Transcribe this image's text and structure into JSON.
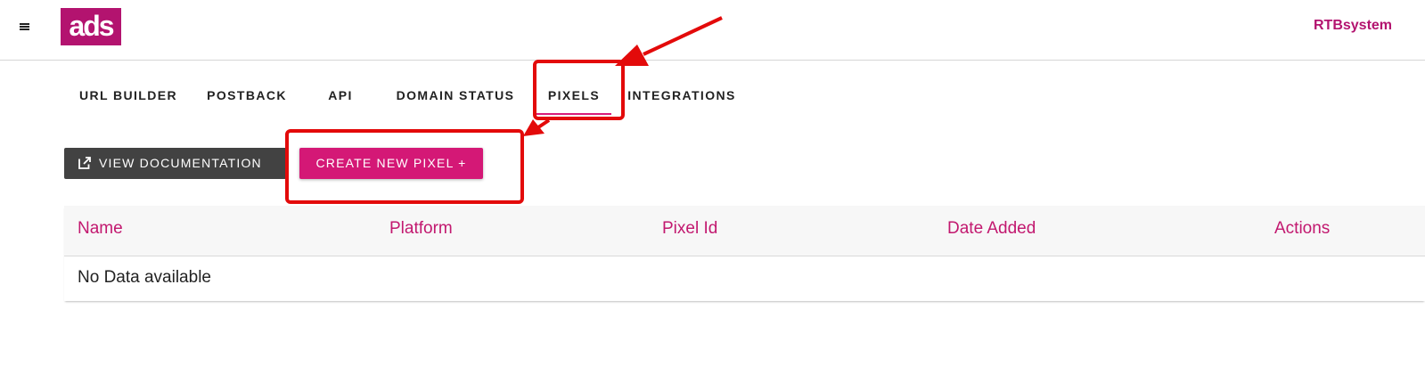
{
  "header": {
    "logo_text": "ads",
    "brand": "RTBsystem",
    "colors": {
      "brand": "#b3136f",
      "accent": "#d41876"
    }
  },
  "tabs": [
    {
      "label": "URL BUILDER"
    },
    {
      "label": "POSTBACK"
    },
    {
      "label": "API"
    },
    {
      "label": "DOMAIN STATUS"
    },
    {
      "label": "PIXELS",
      "active": true
    },
    {
      "label": "INTEGRATIONS"
    }
  ],
  "actions": {
    "view_docs_label": "VIEW DOCUMENTATION",
    "view_docs_icon": "open-in-new-icon",
    "create_label": "CREATE NEW PIXEL +"
  },
  "table": {
    "columns": [
      "Name",
      "Platform",
      "Pixel Id",
      "Date Added",
      "Actions"
    ],
    "empty_text": "No Data available"
  },
  "annotations": {
    "color": "#e30a0a"
  }
}
